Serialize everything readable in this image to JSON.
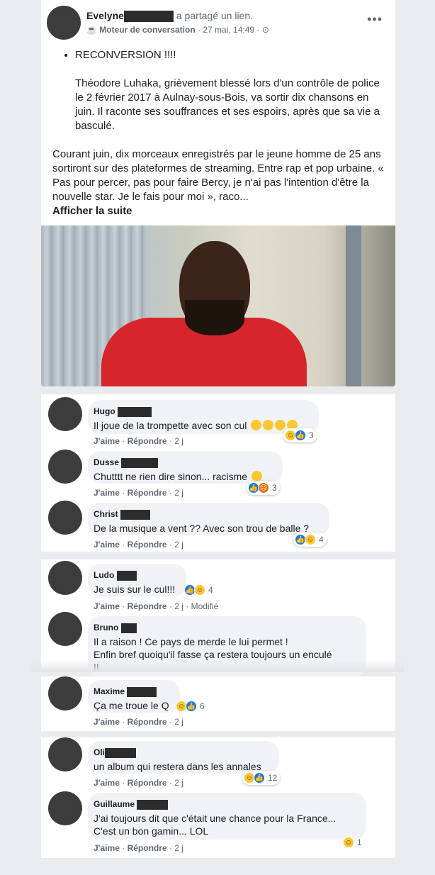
{
  "post": {
    "author": "Evelyne",
    "shared": "a partagé un lien.",
    "group": "Moteur de conversation",
    "date": "· 27 mai, 14:49 ·",
    "more_icon": "more-dots-icon",
    "bullet_title": "RECONVERSION !!!!",
    "bullet_text": "Théodore Luhaka, grièvement blessé lors d'un contrôle de police le 2 février 2017 à Aulnay-sous-Bois, va sortir dix chansons en juin. Il raconte ses souffrances et ses espoirs, après que sa vie a basculé.",
    "body": "Courant juin, dix morceaux enregistrés par le jeune homme de 25 ans sortiront sur des plateformes de streaming. Entre rap et pop urbaine. « Pas pour percer, pas pour faire Bercy, je n'ai pas l'intention d'être la nouvelle star. Je le fais pour moi », raco...",
    "see_more": "Afficher la suite"
  },
  "comments": [
    {
      "name": "Hugo",
      "text": "Il joue de la trompette avec son cul",
      "time": "2 j",
      "reactions": [
        "haha",
        "like"
      ],
      "count": "3"
    },
    {
      "name": "Dusse",
      "text": "Chutttt ne rien dire sinon... racisme",
      "time": "2 j",
      "reactions": [
        "like",
        "angry"
      ],
      "count": "3"
    },
    {
      "name": "Christ",
      "text": "De la musique a vent ?? Avec son trou de balle ?",
      "time": "2 j",
      "reactions": [
        "like",
        "haha"
      ],
      "count": "4"
    },
    {
      "name": "Ludo",
      "text": "Je suis sur le cul!!!",
      "time": "2 j · Modifié",
      "reactions": [
        "like",
        "haha"
      ],
      "count": "4"
    },
    {
      "name": "Bruno",
      "text": "Il a raison ! Ce pays de merde le lui permet !\nEnfin bref quoiqu'il fasse ça restera toujours un enculé\n!!",
      "time": "",
      "reactions": [],
      "count": ""
    },
    {
      "name": "Maxime",
      "text": "Ça me troue le Q",
      "time": "2 j",
      "reactions": [
        "haha",
        "like"
      ],
      "count": "6"
    },
    {
      "name": "Oli",
      "text": "un album qui restera dans les annales",
      "time": "2 j",
      "reactions": [
        "haha",
        "like"
      ],
      "count": "12"
    },
    {
      "name": "Guillaume",
      "text": "J'ai toujours dit que c'était une chance pour la France...\nC'est un bon gamin... LOL",
      "time": "2 j",
      "reactions": [
        "haha"
      ],
      "count": "1"
    }
  ],
  "labels": {
    "like": "J'aime",
    "reply": "Répondre",
    "sep": "·"
  },
  "colors": {
    "like": "#1877f2",
    "haha": "#f7c831",
    "angry": "#e9710f",
    "bubble": "#f0f2f5"
  }
}
